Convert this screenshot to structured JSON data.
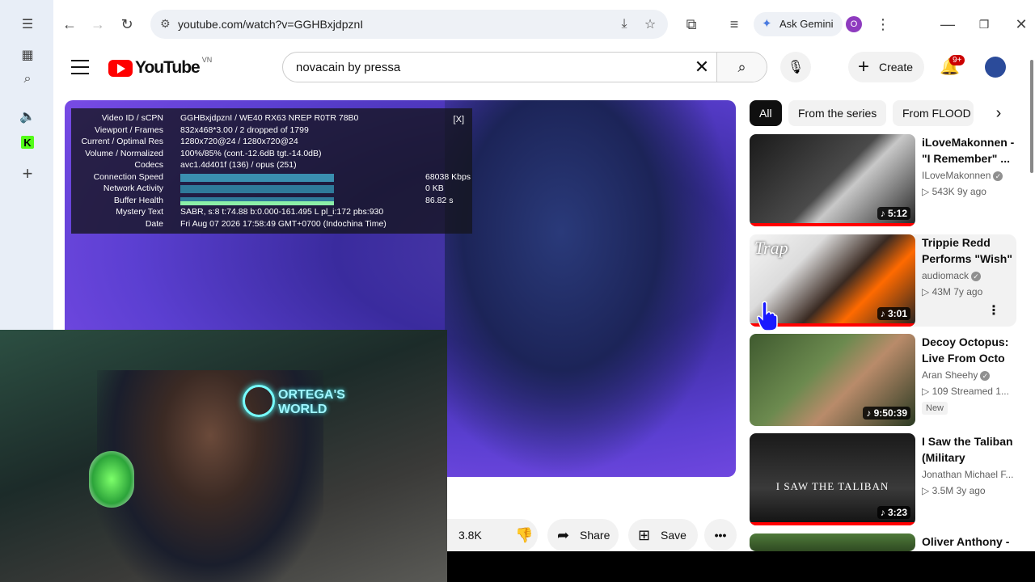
{
  "browser": {
    "url": "youtube.com/watch?v=GGHBxjdpznI",
    "gemini_label": "Ask Gemini",
    "profile_initial": "O"
  },
  "sidebar_icons": [
    "collapse-icon",
    "grid-icon",
    "search-tab-icon",
    "speaker-icon",
    "kick-icon",
    "add-icon"
  ],
  "youtube": {
    "logo_text": "YouTube",
    "country_code": "VN",
    "search_query": "novacain by pressa",
    "create_label": "Create",
    "notif_badge": "9+"
  },
  "stats": {
    "rows": [
      {
        "k": "Video ID / sCPN",
        "v": "GGHBxjdpznI / WE40 RX63 NREP R0TR 78B0"
      },
      {
        "k": "Viewport / Frames",
        "v": "832x468*3.00 / 2 dropped of 1799"
      },
      {
        "k": "Current / Optimal Res",
        "v": "1280x720@24 / 1280x720@24"
      },
      {
        "k": "Volume / Normalized",
        "v": "100%/85% (cont.-12.6dB tgt.-14.0dB)"
      },
      {
        "k": "Codecs",
        "v": "avc1.4d401f (136) / opus (251)"
      }
    ],
    "connection_label": "Connection Speed",
    "connection_value": "68038 Kbps",
    "network_label": "Network Activity",
    "network_value": "0 KB",
    "buffer_label": "Buffer Health",
    "buffer_value": "86.82 s",
    "mystery_label": "Mystery Text",
    "mystery_value": "SABR, s:8 t:74.88 b:0.000-161.495 L pl_i:172 pbs:930",
    "date_label": "Date",
    "date_value": "Fri Aug 07 2026 17:58:49 GMT+0700 (Indochina Time)",
    "close": "[X]"
  },
  "webcam": {
    "neon_text": "ORTEGA'S WORLD"
  },
  "actions": {
    "like_count": "3.8K",
    "share_label": "Share",
    "save_label": "Save"
  },
  "chips": [
    {
      "label": "All",
      "active": true
    },
    {
      "label": "From the series",
      "active": false
    },
    {
      "label": "From FLOOD",
      "active": false
    }
  ],
  "recs": [
    {
      "title": "iLoveMakonnen - \"I Remember\" ...",
      "channel": "ILoveMakonnen",
      "meta": "▷ 543K  9y ago",
      "duration": "♪ 5:12"
    },
    {
      "title": "Trippie Redd Performs \"Wish\" ...",
      "channel": "audiomack",
      "meta": "▷ 43M  7y ago",
      "duration": "♪ 3:01",
      "thumb_text": "Trap"
    },
    {
      "title": "Decoy Octopus: Live From Octo ...",
      "channel": "Aran Sheehy",
      "meta": "▷ 109  Streamed 1...",
      "duration": "♪ 9:50:39",
      "badge": "New"
    },
    {
      "title": "I Saw the Taliban (Military Cadenc...",
      "channel": "Jonathan Michael F...",
      "meta": "▷ 3.5M  3y ago",
      "duration": "♪ 3:23",
      "thumb_text": "I SAW THE TALIBAN"
    },
    {
      "title": "Oliver Anthony -",
      "channel": "",
      "meta": "",
      "duration": ""
    }
  ]
}
